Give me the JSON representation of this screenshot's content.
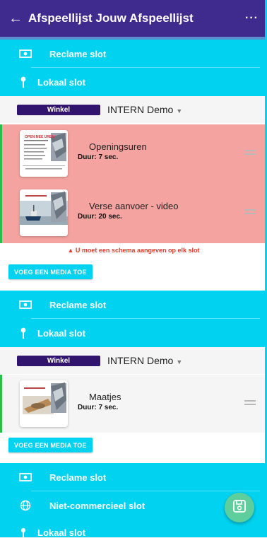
{
  "header": {
    "title": "Afspeellijst Jouw Afspeellijst",
    "back_icon": "arrow-left-icon",
    "more_icon": "more-horizontal-icon"
  },
  "slots": {
    "reclame_1": {
      "label": "Reclame slot",
      "icon": "money-icon"
    },
    "lokaal_1": {
      "label": "Lokaal slot",
      "icon": "pin-icon"
    },
    "reclame_2": {
      "label": "Reclame slot",
      "icon": "money-icon"
    },
    "lokaal_2": {
      "label": "Lokaal slot",
      "icon": "pin-icon"
    },
    "reclame_3": {
      "label": "Reclame slot",
      "icon": "money-icon"
    },
    "nietcommercieel": {
      "label": "Niet-commercieel slot",
      "icon": "globe-icon"
    },
    "lokaal_3": {
      "label": "Lokaal slot",
      "icon": "pin-icon"
    }
  },
  "stores": [
    {
      "badge": "Winkel",
      "selected": "INTERN Demo"
    },
    {
      "badge": "Winkel",
      "selected": "INTERN Demo"
    }
  ],
  "group1": [
    {
      "title": "Openingsuren",
      "duration": "Duur: 7 sec.",
      "thumb_text": "OPEN MEE UREN"
    },
    {
      "title": "Verse aanvoer - video",
      "duration": "Duur: 20 sec."
    }
  ],
  "warning": "U moet een schema aangeven op elk slot",
  "add_media_label": "VOEG EEN MEDIA TOE",
  "group2": [
    {
      "title": "Maatjes",
      "duration": "Duur: 7 sec."
    }
  ],
  "fab_icon": "save-icon",
  "colors": {
    "appbar": "#3f2a8e",
    "slot": "#00d2f0",
    "error_bg": "#f5a3a0",
    "accent_green": "#2bbf4a",
    "fab": "#5ecf9c",
    "badge": "#30146e"
  }
}
